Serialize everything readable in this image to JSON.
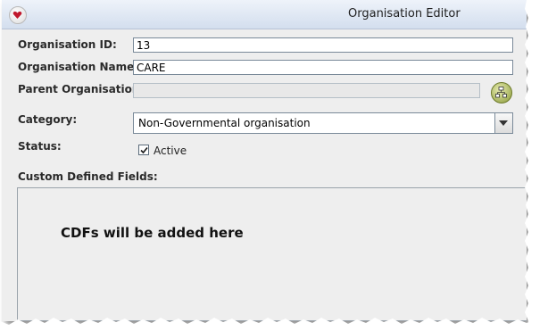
{
  "window": {
    "title": "Organisation Editor",
    "icon": "heart-arrow-icon"
  },
  "form": {
    "organisation_id": {
      "label": "Organisation ID:",
      "value": "13"
    },
    "organisation_name": {
      "label": "Organisation Name:",
      "value": "CARE"
    },
    "parent_organisation": {
      "label": "Parent Organisation:",
      "value": "",
      "button_icon": "hierarchy-icon"
    },
    "category": {
      "label": "Category:",
      "selected": "Non-Governmental organisation"
    },
    "status": {
      "label": "Status:",
      "checkbox_label": "Active",
      "checked": true
    },
    "custom_fields": {
      "label": "Custom Defined Fields:",
      "note": "CDFs will be added here"
    }
  }
}
